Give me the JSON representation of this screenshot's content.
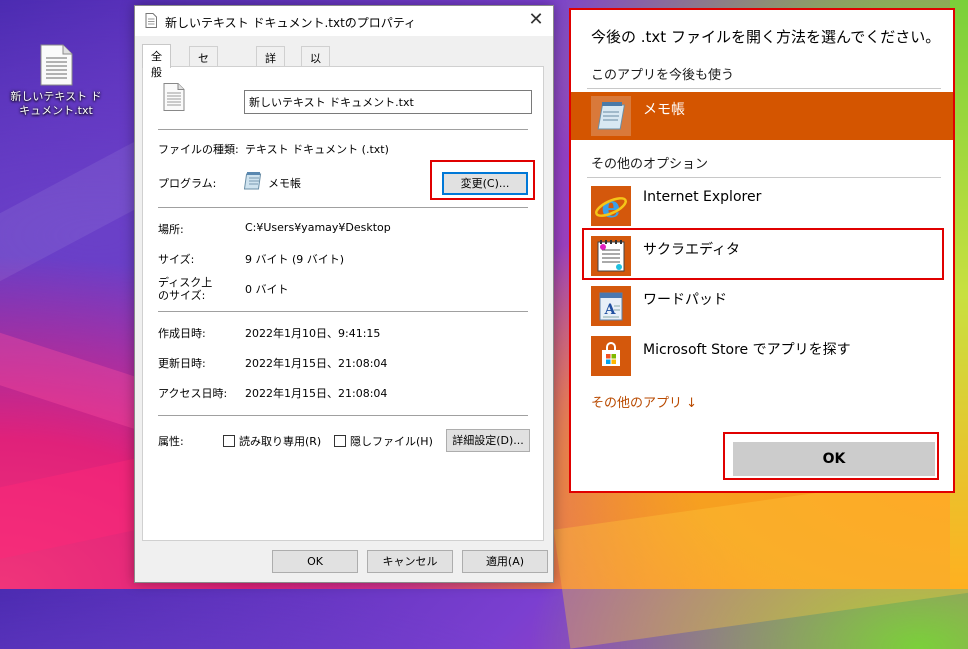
{
  "desktop": {
    "icon_label": "新しいテキスト ドキュメント.txt"
  },
  "properties": {
    "title": "新しいテキスト ドキュメント.txtのプロパティ",
    "tabs": [
      "全般",
      "セキュリティ",
      "詳細",
      "以前のバージョン"
    ],
    "filename": "新しいテキスト ドキュメント.txt",
    "filetype_label": "ファイルの種類:",
    "filetype_value": "テキスト ドキュメント (.txt)",
    "program_label": "プログラム:",
    "program_value": "メモ帳",
    "change_button": "変更(C)...",
    "location_label": "場所:",
    "location_value": "C:¥Users¥yamay¥Desktop",
    "size_label": "サイズ:",
    "size_value": "9 バイト (9 バイト)",
    "disksize_label_1": "ディスク上",
    "disksize_label_2": "のサイズ:",
    "disksize_value": "0 バイト",
    "created_label": "作成日時:",
    "created_value": "2022年1月10日、9:41:15",
    "modified_label": "更新日時:",
    "modified_value": "2022年1月15日、21:08:04",
    "accessed_label": "アクセス日時:",
    "accessed_value": "2022年1月15日、21:08:04",
    "attributes_label": "属性:",
    "readonly_label": "読み取り専用(R)",
    "hidden_label": "隠しファイル(H)",
    "advanced_button": "詳細設定(D)...",
    "ok_button": "OK",
    "cancel_button": "キャンセル",
    "apply_button": "適用(A)"
  },
  "open_with": {
    "title": "今後の .txt ファイルを開く方法を選んでください。",
    "keep_using_label": "このアプリを今後も使う",
    "selected_app": "メモ帳",
    "other_options_label": "その他のオプション",
    "apps": [
      "Internet Explorer",
      "サクラエディタ",
      "ワードパッド",
      "Microsoft Store でアプリを探す"
    ],
    "more_apps": "その他のアプリ ↓",
    "ok_button": "OK",
    "accent_color": "#d45500",
    "highlight_color": "#e00000"
  }
}
